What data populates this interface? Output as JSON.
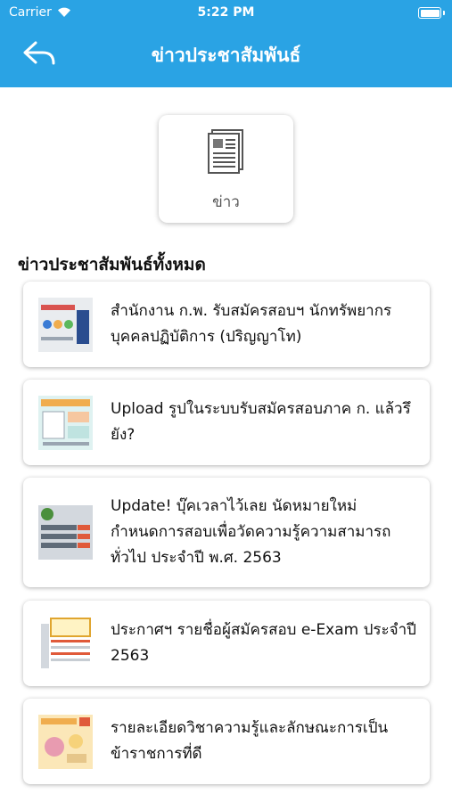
{
  "status": {
    "carrier": "Carrier",
    "time": "5:22 PM"
  },
  "header": {
    "title": "ข่าวประชาสัมพันธ์",
    "accent": "#2aa3e4"
  },
  "category": {
    "label": "ข่าว",
    "icon": "newspaper-icon"
  },
  "section": {
    "title": "ข่าวประชาสัมพันธ์ทั้งหมด"
  },
  "news": [
    {
      "title": "สำนักงาน ก.พ. รับสมัครสอบฯ นักทรัพยากรบุคคลปฏิบัติการ (ปริญญาโท)"
    },
    {
      "title": "Upload รูปในระบบรับสมัครสอบภาค ก. แล้วรึยัง?"
    },
    {
      "title": "Update! บุ๊คเวลาไว้เลย นัดหมายใหม่ กำหนดการสอบเพื่อวัดความรู้ความสามารถทั่วไป ประจำปี พ.ศ. 2563"
    },
    {
      "title": "ประกาศฯ รายชื่อผู้สมัครสอบ e-Exam ประจำปี 2563"
    },
    {
      "title": "รายละเอียดวิชาความรู้และลักษณะการเป็นข้าราชการที่ดี"
    }
  ]
}
